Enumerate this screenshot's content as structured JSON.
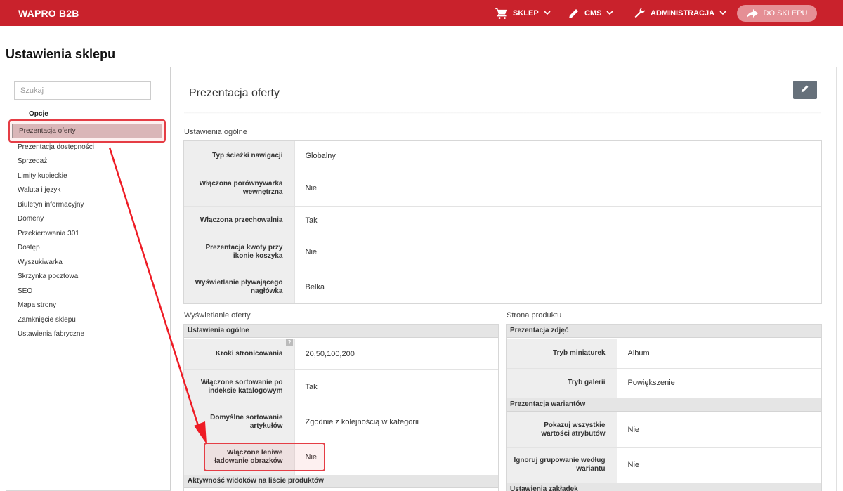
{
  "header": {
    "brand": "WAPRO B2B",
    "nav": [
      {
        "label": "SKLEP",
        "icon": "cart-icon"
      },
      {
        "label": "CMS",
        "icon": "pencil-icon"
      },
      {
        "label": "ADMINISTRACJA",
        "icon": "wrench-icon"
      }
    ],
    "shop_button": "DO SKLEPU",
    "accent": "#c9222c"
  },
  "page_title": "Ustawienia sklepu",
  "sidebar": {
    "search_placeholder": "Szukaj",
    "group_label": "Opcje",
    "items": [
      "Prezentacja oferty",
      "Prezentacja dostępności",
      "Sprzedaż",
      "Limity kupieckie",
      "Waluta i język",
      "Biuletyn informacyjny",
      "Domeny",
      "Przekierowania 301",
      "Dostęp",
      "Wyszukiwarka",
      "Skrzynka pocztowa",
      "SEO",
      "Mapa strony",
      "Zamknięcie sklepu",
      "Ustawienia fabryczne"
    ],
    "active_index": 0
  },
  "main": {
    "title": "Prezentacja oferty",
    "general": {
      "label": "Ustawienia ogólne",
      "rows": [
        {
          "key": "Typ ścieżki nawigacji",
          "value": "Globalny"
        },
        {
          "key": "Włączona porównywarka wewnętrzna",
          "value": "Nie"
        },
        {
          "key": "Włączona przechowalnia",
          "value": "Tak"
        },
        {
          "key": "Prezentacja kwoty przy ikonie koszyka",
          "value": "Nie"
        },
        {
          "key": "Wyświetlanie pływającego nagłówka",
          "value": "Belka"
        }
      ]
    },
    "offer_display": {
      "label": "Wyświetlanie oferty",
      "subhead": "Ustawienia ogólne",
      "help": "?",
      "rows": [
        {
          "key": "Kroki stronicowania",
          "value": "20,50,100,200"
        },
        {
          "key": "Włączone sortowanie po indeksie katalogowym",
          "value": "Tak"
        },
        {
          "key": "Domyślne sortowanie artykułów",
          "value": "Zgodnie z kolejnością w kategorii"
        },
        {
          "key": "Włączone leniwe ładowanie obrazków",
          "value": "Nie"
        }
      ],
      "subhead2": "Aktywność widoków na liście produktów"
    },
    "product_page": {
      "label": "Strona produktu",
      "subhead": "Prezentacja zdjęć",
      "rows": [
        {
          "key": "Tryb miniaturek",
          "value": "Album"
        },
        {
          "key": "Tryb galerii",
          "value": "Powiększenie"
        }
      ],
      "subhead2": "Prezentacja wariantów",
      "rows2": [
        {
          "key": "Pokazuj wszystkie wartości atrybutów",
          "value": "Nie"
        },
        {
          "key": "Ignoruj grupowanie według wariantu",
          "value": "Nie"
        }
      ],
      "subhead3": "Ustawienia zakładek"
    }
  }
}
